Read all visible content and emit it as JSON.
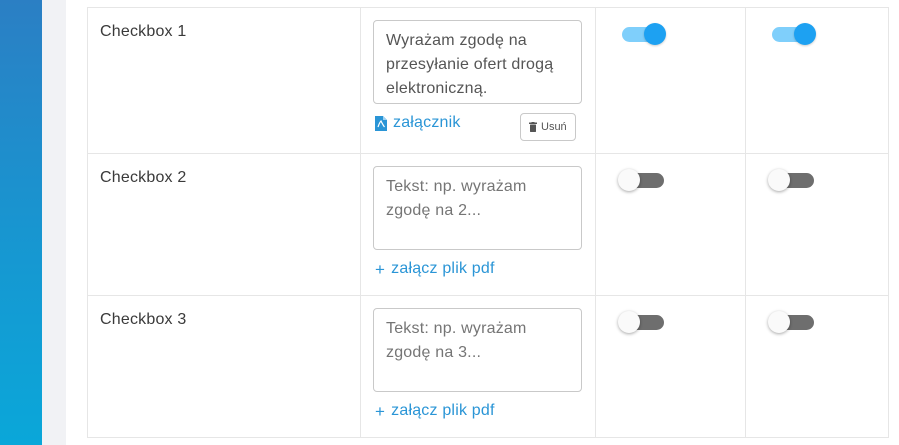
{
  "colors": {
    "accent": "#2a95d6",
    "toggle_on_knob": "#1da1f2",
    "toggle_on_track": "#7fcffb",
    "toggle_off_track": "#6e6e6e",
    "sidebar_gradient_top": "#2b7fc4",
    "sidebar_gradient_bottom": "#0aa7d9"
  },
  "rows": [
    {
      "name": "Checkbox 1",
      "text_value": "Wyrażam zgodę na przesyłanie ofert drogą elektroniczną.",
      "text_placeholder": "",
      "attachment_label": "załącznik",
      "attachment_icon": "pdf-file-icon",
      "remove_label": "Usuń",
      "remove_icon": "trash-icon",
      "toggle_1_on": true,
      "toggle_2_on": true
    },
    {
      "name": "Checkbox 2",
      "text_value": "",
      "text_placeholder": "Tekst: np. wyrażam zgodę na 2...",
      "attach_pdf_label": "załącz plik pdf",
      "attach_icon": "plus-icon",
      "toggle_1_on": false,
      "toggle_2_on": false
    },
    {
      "name": "Checkbox 3",
      "text_value": "",
      "text_placeholder": "Tekst: np. wyrażam zgodę na 3...",
      "attach_pdf_label": "załącz plik pdf",
      "attach_icon": "plus-icon",
      "toggle_1_on": false,
      "toggle_2_on": false
    }
  ]
}
